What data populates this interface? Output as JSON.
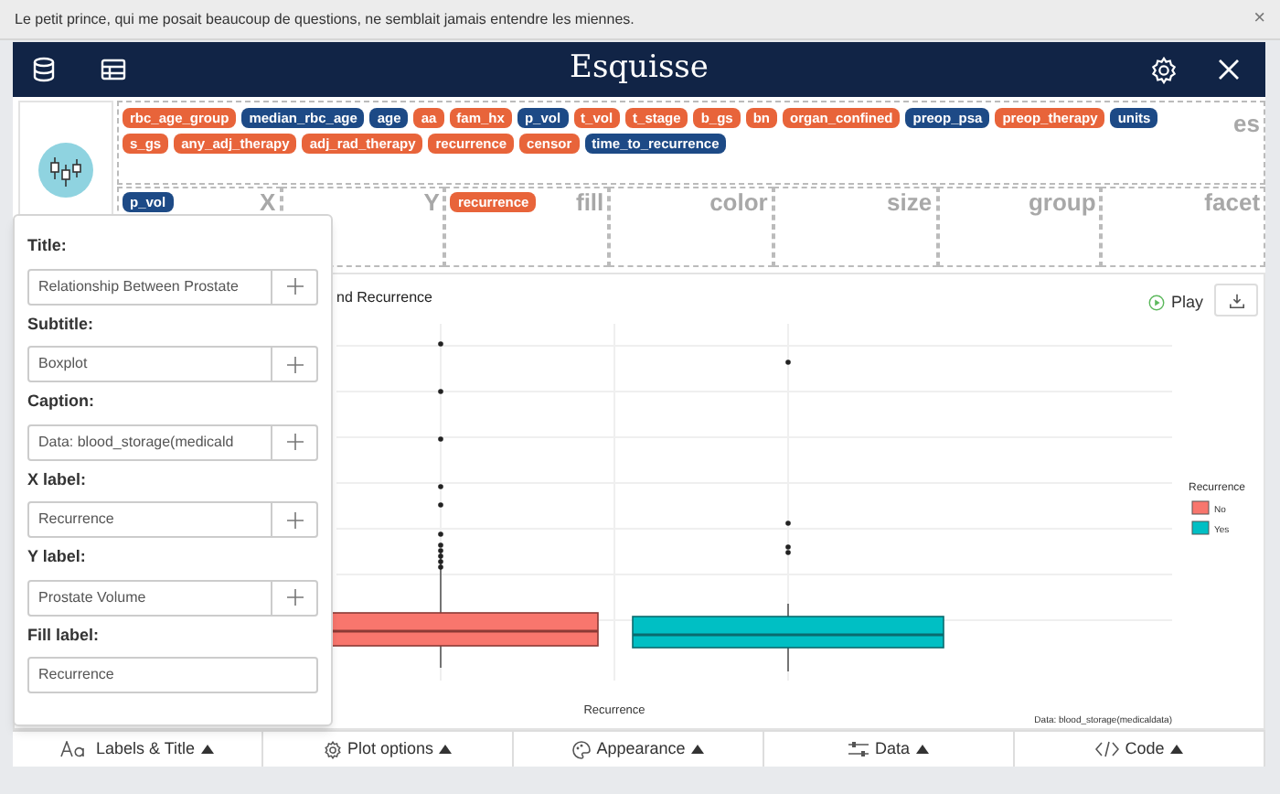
{
  "notification": {
    "text": "Le petit prince, qui me posait beaucoup de questions, ne semblait jamais entendre les miennes.",
    "close": "×"
  },
  "header": {
    "title": "Esquisse"
  },
  "variables": {
    "label_fragment": "es",
    "rows": [
      {
        "chips": [
          {
            "label": "rbc_age_group",
            "color": "#e8643a"
          },
          {
            "label": "median_rbc_age",
            "color": "#1d4a86"
          },
          {
            "label": "age",
            "color": "#1d4a86"
          },
          {
            "label": "aa",
            "color": "#e8643a"
          },
          {
            "label": "fam_hx",
            "color": "#e8643a"
          },
          {
            "label": "p_vol",
            "color": "#1d4a86"
          },
          {
            "label": "t_vol",
            "color": "#e8643a"
          },
          {
            "label": "t_stage",
            "color": "#e8643a"
          },
          {
            "label": "b_gs",
            "color": "#e8643a"
          },
          {
            "label": "bn",
            "color": "#e8643a"
          },
          {
            "label": "organ_confined",
            "color": "#e8643a"
          },
          {
            "label": "preop_psa",
            "color": "#1d4a86"
          },
          {
            "label": "preop_therapy",
            "color": "#e8643a"
          },
          {
            "label": "units",
            "color": "#1d4a86"
          }
        ]
      },
      {
        "chips": [
          {
            "label": "s_gs",
            "color": "#e8643a"
          },
          {
            "label": "any_adj_therapy",
            "color": "#e8643a"
          },
          {
            "label": "adj_rad_therapy",
            "color": "#e8643a"
          },
          {
            "label": "recurrence",
            "color": "#e8643a"
          },
          {
            "label": "censor",
            "color": "#e8643a"
          },
          {
            "label": "time_to_recurrence",
            "color": "#1d4a86"
          }
        ]
      }
    ]
  },
  "drop_zones": [
    {
      "label": "X",
      "chips": [
        {
          "label": "p_vol",
          "color": "#1d4a86"
        }
      ]
    },
    {
      "label": "Y"
    },
    {
      "label": "fill",
      "chips": [
        {
          "label": "recurrence",
          "color": "#e8643a"
        }
      ]
    },
    {
      "label": "color"
    },
    {
      "label": "size"
    },
    {
      "label": "group"
    },
    {
      "label": "facet"
    }
  ],
  "plot": {
    "title_fragment": "nd Recurrence",
    "x_title": "Recurrence",
    "caption": "Data: blood_storage(medicaldata)",
    "legend": {
      "title": "Recurrence",
      "items": [
        {
          "label": "No",
          "color": "#f8766d"
        },
        {
          "label": "Yes",
          "color": "#00bfc4"
        }
      ]
    },
    "play": "Play"
  },
  "labels_popup": {
    "fields": [
      {
        "label": "Title:",
        "value": "Relationship Between Prostate",
        "add": true
      },
      {
        "label": "Subtitle:",
        "value": "Boxplot",
        "add": true
      },
      {
        "label": "Caption:",
        "value": "Data: blood_storage(medicald",
        "add": true
      },
      {
        "label": "X label:",
        "value": "Recurrence",
        "add": true
      },
      {
        "label": "Y label:",
        "value": "Prostate Volume",
        "add": true
      },
      {
        "label": "Fill label:",
        "value": "Recurrence",
        "add": false
      }
    ]
  },
  "bottom_tabs": [
    {
      "label": "Labels & Title",
      "kind": "labels"
    },
    {
      "label": "Plot options",
      "kind": "options"
    },
    {
      "label": "Appearance",
      "kind": "appearance"
    },
    {
      "label": "Data",
      "kind": "data"
    },
    {
      "label": "Code",
      "kind": "code"
    }
  ]
}
